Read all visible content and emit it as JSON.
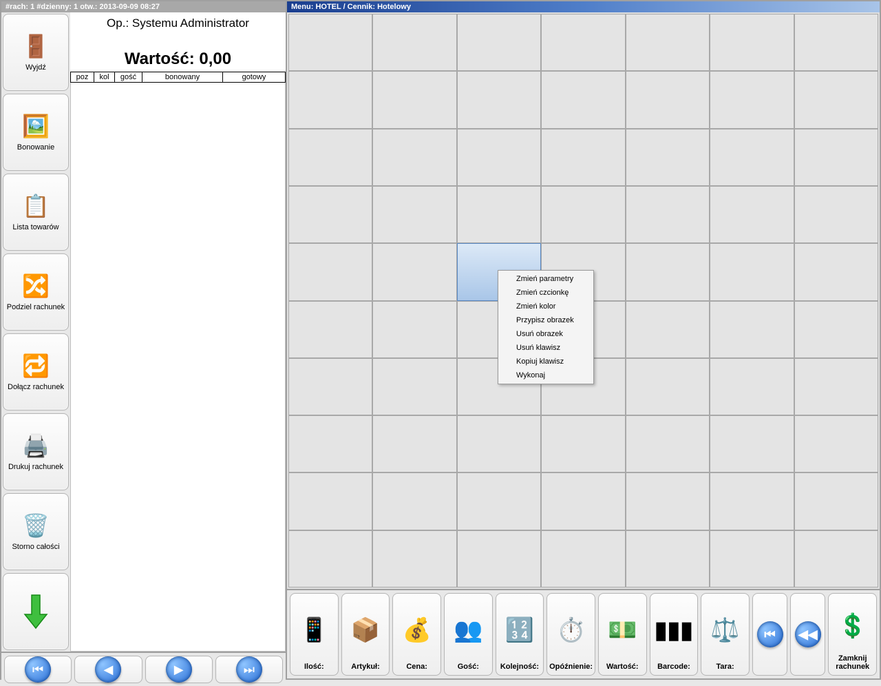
{
  "left_title": "#rach: 1 #dzienny: 1 otw.: 2013-09-09 08:27",
  "right_title": "Menu: HOTEL / Cennik: Hotelowy",
  "op_label": "Op.: Systemu Administrator",
  "value_label": "Wartość: 0,00",
  "cols": {
    "poz": "poz",
    "kol": "kol",
    "gosc": "gość",
    "bonowany": "bonowany",
    "gotowy": "gotowy"
  },
  "sidebar": {
    "wyjdz": "Wyjdź",
    "bonowanie": "Bonowanie",
    "lista": "Lista towarów",
    "podziel": "Podziel rachunek",
    "dolacz": "Dołącz rachunek",
    "drukuj": "Drukuj rachunek",
    "storno": "Storno całości"
  },
  "grid": {
    "selected_row": 4,
    "selected_col": 2,
    "rows": 10,
    "cols": 7
  },
  "context_menu": {
    "items": [
      "Zmień parametry",
      "Zmień czcionkę",
      "Zmień kolor",
      "Przypisz obrazek",
      "Usuń obrazek",
      "Usuń klawisz",
      "Kopiuj klawisz",
      "Wykonaj"
    ]
  },
  "bottom": {
    "ilosc": "Ilość:",
    "artykul": "Artykuł:",
    "cena": "Cena:",
    "gosc": "Gość:",
    "kolejnosc": "Kolejność:",
    "opoznienie": "Opóźnienie:",
    "wartosc": "Wartość:",
    "barcode": "Barcode:",
    "tara": "Tara:",
    "zamknij": "Zamknij rachunek"
  }
}
